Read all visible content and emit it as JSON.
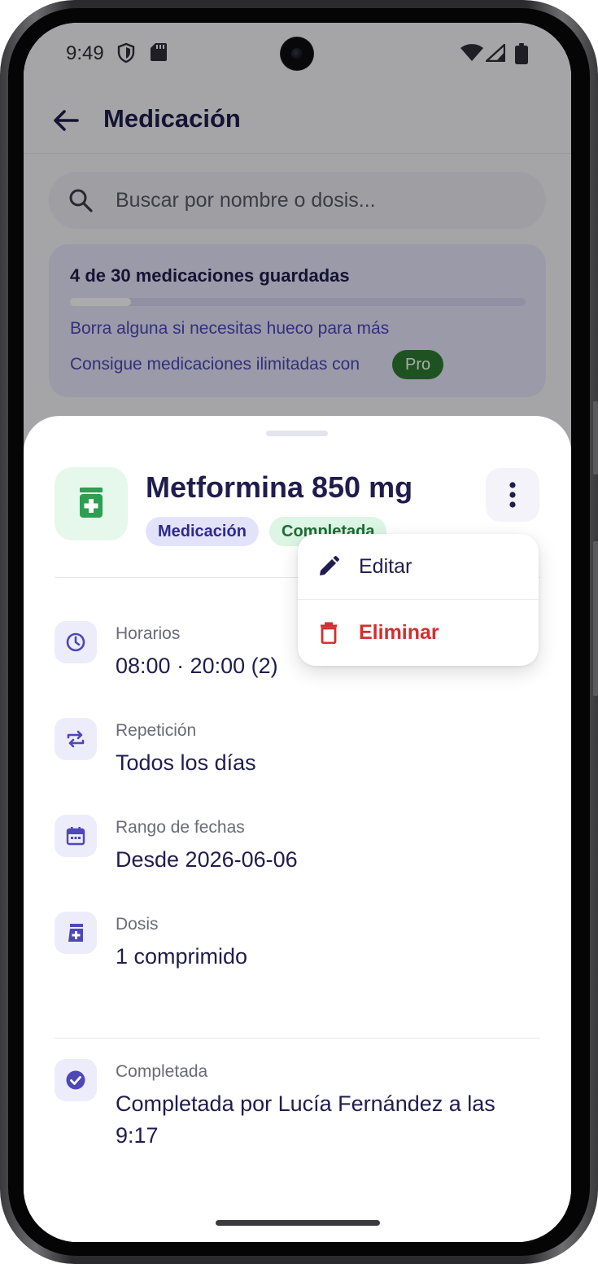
{
  "status_bar": {
    "time": "9:49"
  },
  "header": {
    "title": "Medicación"
  },
  "search": {
    "placeholder": "Buscar por nombre o dosis..."
  },
  "quota": {
    "title": "4 de 30 medicaciones guardadas",
    "used": 4,
    "limit": 30,
    "message": "Borra alguna si necesitas hueco para más",
    "promo": "Consigue medicaciones ilimitadas con",
    "pro_label": "Pro"
  },
  "sheet": {
    "name": "Metformina 850 mg",
    "type_chip": "Medicación",
    "status_chip": "Completada",
    "details": [
      {
        "label": "Horarios",
        "value": "08:00 · 20:00 (2)",
        "icon": "clock-icon"
      },
      {
        "label": "Repetición",
        "value": "Todos los días",
        "icon": "repeat-icon"
      },
      {
        "label": "Rango de fechas",
        "value": "Desde 2026-06-06",
        "icon": "calendar-icon"
      },
      {
        "label": "Dosis",
        "value": "1 comprimido",
        "icon": "medication-dose-icon"
      }
    ],
    "completion": {
      "label": "Completada",
      "value": "Completada por Lucía Fernández a las 9:17",
      "icon": "check-circle-icon"
    }
  },
  "menu": {
    "edit_label": "Editar",
    "delete_label": "Eliminar"
  },
  "colors": {
    "primary": "#4E47B8",
    "title": "#1F1D4D",
    "success": "#2E7D32",
    "danger": "#D32F2F",
    "sheet_background": "#FFFFFF"
  }
}
